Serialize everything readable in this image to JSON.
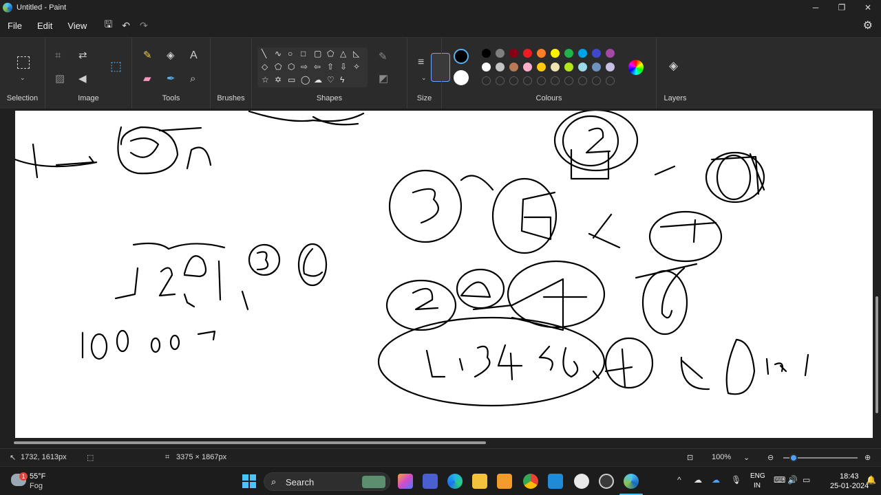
{
  "window": {
    "title": "Untitled - Paint",
    "minimize": "─",
    "maximize": "❐",
    "close": "✕"
  },
  "menu": {
    "file": "File",
    "edit": "Edit",
    "view": "View",
    "save_icon": "save-icon",
    "undo_icon": "undo-icon",
    "redo_icon": "redo-icon"
  },
  "ribbon": {
    "groups": {
      "selection": "Selection",
      "image": "Image",
      "tools": "Tools",
      "brushes": "Brushes",
      "shapes": "Shapes",
      "size": "Size",
      "colours": "Colours",
      "layers": "Layers"
    }
  },
  "colours": {
    "primary": "#000000",
    "secondary": "#ffffff",
    "row1": [
      "#000000",
      "#7f7f7f",
      "#880015",
      "#ed1c24",
      "#ff7f27",
      "#fff200",
      "#22b14c",
      "#00a2e8",
      "#3f48cc",
      "#a349a4"
    ],
    "row2": [
      "#ffffff",
      "#c3c3c3",
      "#b97a57",
      "#ffaec9",
      "#ffc90e",
      "#efe4b0",
      "#b5e61d",
      "#99d9ea",
      "#7092be",
      "#c8bfe7"
    ]
  },
  "status": {
    "cursor_pos": "1732, 1613px",
    "canvas_size": "3375 × 1867px",
    "zoom": "100%"
  },
  "taskbar": {
    "weather_temp": "55°F",
    "weather_desc": "Fog",
    "weather_badge": "1",
    "search_label": "Search",
    "lang_line1": "ENG",
    "lang_line2": "IN",
    "time": "18:43",
    "date": "25-01-2024"
  }
}
